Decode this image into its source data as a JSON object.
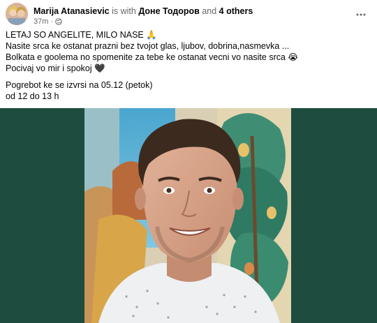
{
  "post": {
    "author": "Marija Atanasievic",
    "with_text": "is with",
    "tagged_person": "Доне Тодоров",
    "and_text": "and",
    "others": "4 others",
    "time": "37m",
    "privacy_icon": "globe-icon",
    "more_icon": "more-options-icon",
    "lines": [
      "LETAJ SO ANGELITE, MILO NASE 🙏",
      "Nasite srca ke ostanat prazni bez tvojot glas, ljubov, dobrina,nasmevka ...",
      "Bolkata e goolema no spomenite za tebe ke ostanat  vecni vo nasite srca 😭",
      "Pocivaj vo mir i spokoj 🖤"
    ],
    "lines2": [
      "Pogrebot ke se izvrsi na 05.12 (petok)",
      "od 12 do 13 h"
    ],
    "photo_bg_color": "#1e4d3f"
  }
}
